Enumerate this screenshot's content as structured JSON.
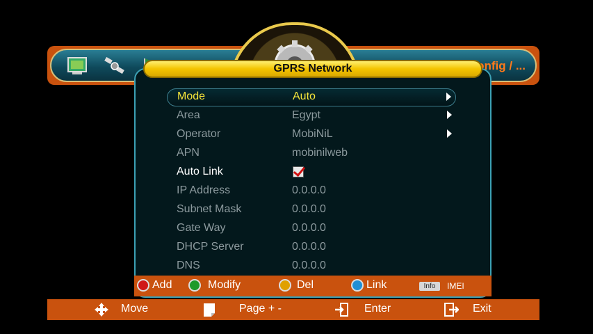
{
  "header": {
    "breadcrumb": "onfig / ..."
  },
  "dialog": {
    "title": "GPRS Network",
    "rows": [
      {
        "label": "Mode",
        "value": "Auto"
      },
      {
        "label": "Area",
        "value": "Egypt"
      },
      {
        "label": "Operator",
        "value": "MobiNiL"
      },
      {
        "label": "APN",
        "value": "mobinilweb"
      },
      {
        "label": "Auto Link",
        "checked": true
      },
      {
        "label": "IP Address",
        "value": "0.0.0.0"
      },
      {
        "label": "Subnet Mask",
        "value": "0.0.0.0"
      },
      {
        "label": "Gate Way",
        "value": "0.0.0.0"
      },
      {
        "label": "DHCP Server",
        "value": "0.0.0.0"
      },
      {
        "label": "DNS",
        "value": "0.0.0.0"
      }
    ]
  },
  "keys": {
    "red": "Add",
    "green": "Modify",
    "yellow": "Del",
    "blue": "Link",
    "info_badge": "Info",
    "info_label": "IMEI"
  },
  "nav": {
    "move": "Move",
    "page": "Page + -",
    "enter": "Enter",
    "exit": "Exit"
  },
  "colors": {
    "accent_orange": "#c9520e",
    "selected_text": "#f5e53a",
    "title_yellow": "#f4c400",
    "dialog_border": "#3ca1b5"
  }
}
